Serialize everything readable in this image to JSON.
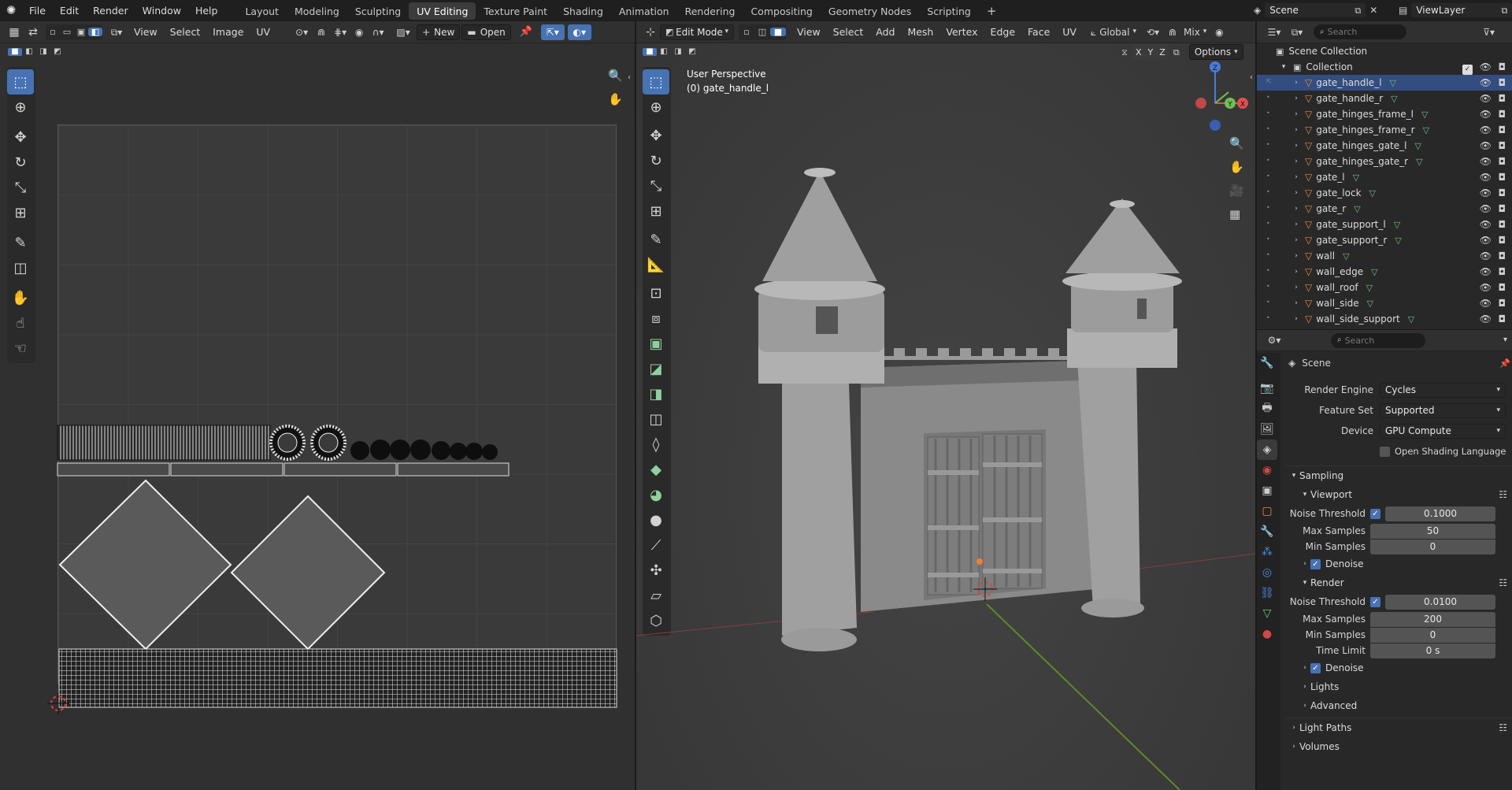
{
  "topbar": {
    "menus": [
      "File",
      "Edit",
      "Render",
      "Window",
      "Help"
    ],
    "workspaces": [
      "Layout",
      "Modeling",
      "Sculpting",
      "UV Editing",
      "Texture Paint",
      "Shading",
      "Animation",
      "Rendering",
      "Compositing",
      "Geometry Nodes",
      "Scripting"
    ],
    "active_workspace": "UV Editing",
    "add_tab": "+",
    "scene_name": "Scene",
    "view_layer": "ViewLayer"
  },
  "uv_editor": {
    "menus": [
      "View",
      "Select",
      "Image",
      "UV"
    ],
    "new_label": "New",
    "open_label": "Open"
  },
  "viewport": {
    "mode": "Edit Mode",
    "menus": [
      "View",
      "Select",
      "Add",
      "Mesh",
      "Vertex",
      "Edge",
      "Face",
      "UV"
    ],
    "transform_orientation": "Global",
    "blend_mode": "Mix",
    "options_label": "Options",
    "axis_x": "X",
    "axis_y": "Y",
    "axis_z": "Z",
    "perspective_label": "User Perspective",
    "object_label": "(0) gate_handle_l"
  },
  "outliner": {
    "search_placeholder": "Search",
    "root": "Scene Collection",
    "collection": "Collection",
    "objects": [
      "gate_handle_l",
      "gate_handle_r",
      "gate_hinges_frame_l",
      "gate_hinges_frame_r",
      "gate_hinges_gate_l",
      "gate_hinges_gate_r",
      "gate_l",
      "gate_lock",
      "gate_r",
      "gate_support_l",
      "gate_support_r",
      "wall",
      "wall_edge",
      "wall_roof",
      "wall_side",
      "wall_side_support"
    ],
    "selected": "gate_handle_l"
  },
  "properties": {
    "search_placeholder": "Search",
    "context": "Scene",
    "render_engine_label": "Render Engine",
    "render_engine": "Cycles",
    "feature_set_label": "Feature Set",
    "feature_set": "Supported",
    "device_label": "Device",
    "device": "GPU Compute",
    "osl_label": "Open Shading Language",
    "sampling": "Sampling",
    "viewport_section": "Viewport",
    "render_section": "Render",
    "noise_threshold_label": "Noise Threshold",
    "max_samples_label": "Max Samples",
    "min_samples_label": "Min Samples",
    "time_limit_label": "Time Limit",
    "denoise_label": "Denoise",
    "viewport_noise_threshold": "0.1000",
    "viewport_max_samples": "50",
    "viewport_min_samples": "0",
    "render_noise_threshold": "0.0100",
    "render_max_samples": "200",
    "render_min_samples": "0",
    "render_time_limit": "0 s",
    "lights": "Lights",
    "advanced": "Advanced",
    "light_paths": "Light Paths",
    "volumes": "Volumes"
  },
  "colors": {
    "accent": "#4772b3",
    "selected_row": "#334d80",
    "object_orange": "#e88a3c",
    "mesh_green": "#6bc27a"
  }
}
